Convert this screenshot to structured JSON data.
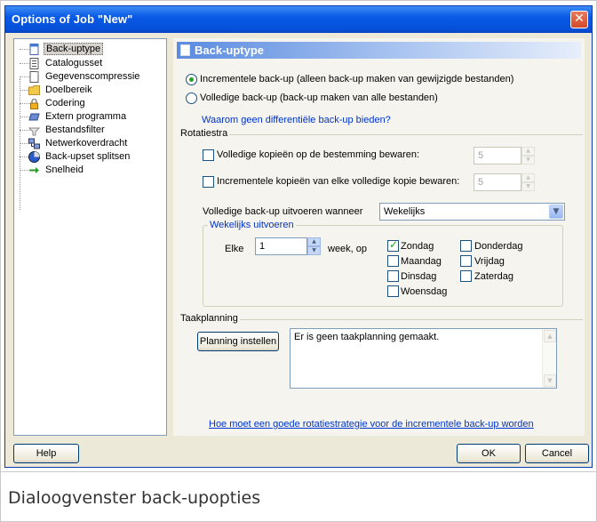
{
  "window": {
    "title": "Options of Job \"New\"",
    "close_glyph": "✕"
  },
  "sidebar": {
    "items": [
      {
        "label": "Back-uptype",
        "icon": "document-icon",
        "selected": true
      },
      {
        "label": "Catalogusset",
        "icon": "catalog-icon"
      },
      {
        "label": "Gegevenscompressie",
        "icon": "compression-icon"
      },
      {
        "label": "Doelbereik",
        "icon": "folder-icon"
      },
      {
        "label": "Codering",
        "icon": "lock-icon"
      },
      {
        "label": "Extern programma",
        "icon": "program-icon"
      },
      {
        "label": "Bestandsfilter",
        "icon": "filter-icon"
      },
      {
        "label": "Netwerkoverdracht",
        "icon": "network-icon"
      },
      {
        "label": "Back-upset splitsen",
        "icon": "split-icon"
      },
      {
        "label": "Snelheid",
        "icon": "speed-icon"
      }
    ]
  },
  "panel": {
    "header": "Back-uptype",
    "radio_incremental": "Incrementele back-up (alleen back-up maken van gewijzigde bestanden)",
    "radio_full": "Volledige back-up (back-up maken van alle bestanden)",
    "link_differential": "Waarom geen differentiële back-up bieden?",
    "rotation": {
      "legend": "Rotatiestra",
      "keep_full_label": "Volledige kopieën op de bestemming bewaren:",
      "keep_full_value": "5",
      "keep_incr_label": "Incrementele kopieën van elke volledige kopie bewaren:",
      "keep_incr_value": "5",
      "run_full_label": "Volledige back-up uitvoeren wanneer",
      "run_full_value": "Wekelijks",
      "weekly": {
        "legend": "Wekelijks uitvoeren",
        "every_label": "Elke",
        "every_value": "1",
        "week_label": "week, op",
        "days": [
          {
            "label": "Zondag",
            "checked": true
          },
          {
            "label": "Maandag",
            "checked": false
          },
          {
            "label": "Dinsdag",
            "checked": false
          },
          {
            "label": "Woensdag",
            "checked": false
          },
          {
            "label": "Donderdag",
            "checked": false
          },
          {
            "label": "Vrijdag",
            "checked": false
          },
          {
            "label": "Zaterdag",
            "checked": false
          }
        ]
      }
    },
    "scheduling": {
      "legend": "Taakplanning",
      "button": "Planning instellen",
      "status_text": "Er is geen taakplanning gemaakt."
    },
    "link_rotation": "Hoe moet een goede rotatiestrategie voor de incrementele back-up worden"
  },
  "buttons": {
    "help": "Help",
    "ok": "OK",
    "cancel": "Cancel"
  },
  "caption": "Dialoogvenster back-upopties",
  "colors": {
    "titlebar": "#0550d8",
    "dialog_bg": "#ece9d8",
    "link": "#0033cc",
    "check": "#21a121"
  }
}
